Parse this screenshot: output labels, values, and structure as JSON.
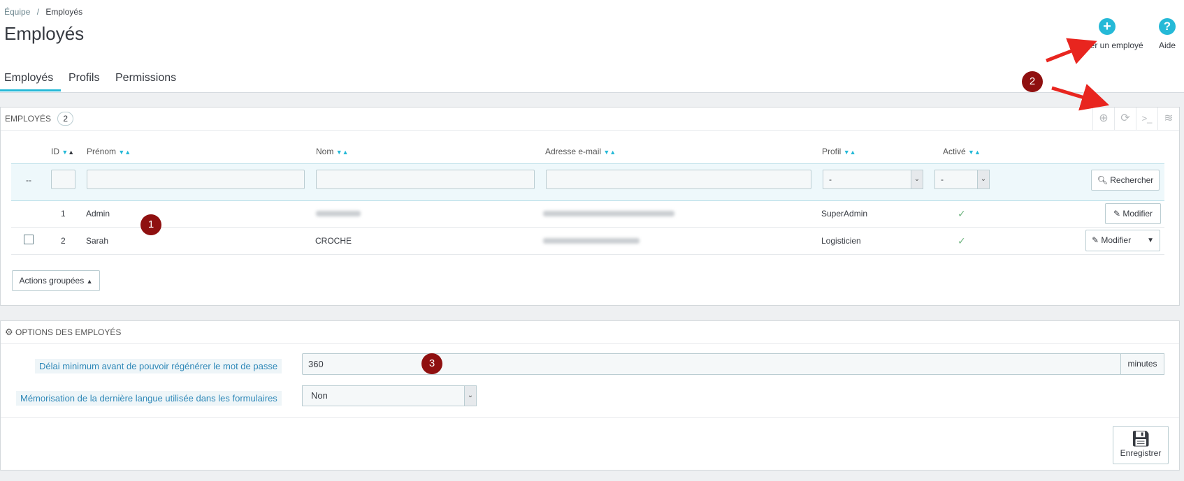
{
  "breadcrumb": {
    "parent": "Équipe",
    "separator": "/",
    "current": "Employés"
  },
  "page_title": "Employés",
  "toolbar": {
    "add_label": "Ajouter un employé",
    "help_label": "Aide"
  },
  "tabs": [
    {
      "label": "Employés",
      "active": true
    },
    {
      "label": "Profils"
    },
    {
      "label": "Permissions"
    }
  ],
  "employees_panel": {
    "title": "Employés",
    "count": "2",
    "icons": [
      "plus-circle-icon",
      "refresh-icon",
      "terminal-icon",
      "database-icon"
    ],
    "columns": {
      "id": "ID",
      "firstname": "Prénom",
      "lastname": "Nom",
      "email": "Adresse e-mail",
      "profile": "Profil",
      "active": "Activé"
    },
    "filter": {
      "dash": "--",
      "profile_select": "-",
      "active_select": "-",
      "search_label": "Rechercher"
    },
    "rows": [
      {
        "id": "1",
        "firstname": "Admin",
        "lastname": "",
        "email": "",
        "profile": "SuperAdmin",
        "active": true,
        "action": "Modifier"
      },
      {
        "id": "2",
        "firstname": "Sarah",
        "lastname": "CROCHE",
        "email": "",
        "profile": "Logisticien",
        "active": true,
        "action": "Modifier"
      }
    ],
    "bulk_actions_label": "Actions groupées"
  },
  "options_panel": {
    "title": "Options des employés",
    "password_delay_label": "Délai minimum avant de pouvoir régénérer le mot de passe",
    "password_delay_value": "360",
    "password_delay_unit": "minutes",
    "language_memo_label": "Mémorisation de la dernière langue utilisée dans les formulaires",
    "language_memo_value": "Non",
    "save_label": "Enregistrer"
  },
  "markers": [
    "1",
    "2",
    "3"
  ],
  "colors": {
    "accent": "#25b9d7",
    "marker": "#8f1010",
    "arrow": "#e8251f",
    "active_check": "#70b580"
  }
}
